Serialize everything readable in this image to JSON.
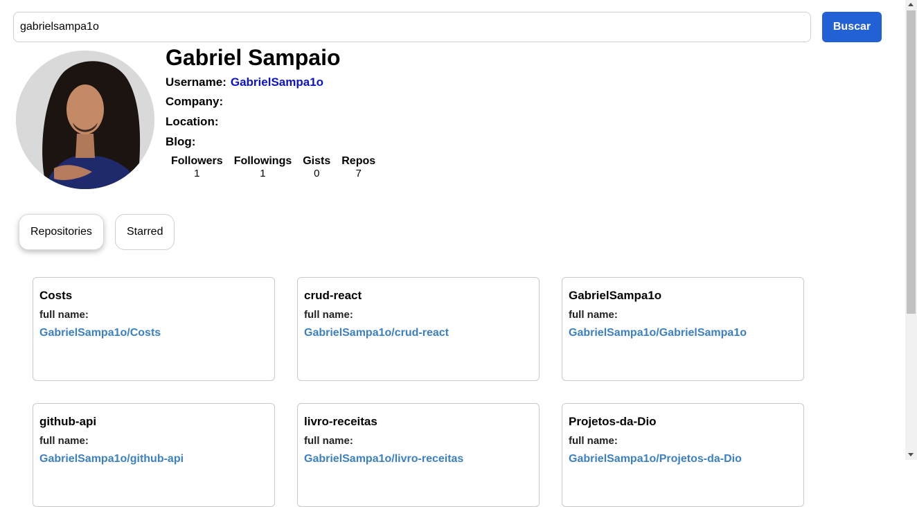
{
  "search": {
    "value": "gabrielsampa1o",
    "button_label": "Buscar"
  },
  "profile": {
    "name": "Gabriel Sampaio",
    "username_label": "Username:",
    "username": "GabrielSampa1o",
    "company_label": "Company:",
    "location_label": "Location:",
    "blog_label": "Blog:",
    "stats": [
      {
        "label": "Followers",
        "value": "1"
      },
      {
        "label": "Followings",
        "value": "1"
      },
      {
        "label": "Gists",
        "value": "0"
      },
      {
        "label": "Repos",
        "value": "7"
      }
    ]
  },
  "tabs": [
    {
      "label": "Repositories",
      "active": true
    },
    {
      "label": "Starred",
      "active": false
    }
  ],
  "repos": [
    {
      "name": "Costs",
      "full_name_label": "full name:",
      "full_name": "GabrielSampa1o/Costs"
    },
    {
      "name": "crud-react",
      "full_name_label": "full name:",
      "full_name": "GabrielSampa1o/crud-react"
    },
    {
      "name": "GabrielSampa1o",
      "full_name_label": "full name:",
      "full_name": "GabrielSampa1o/GabrielSampa1o"
    },
    {
      "name": "github-api",
      "full_name_label": "full name:",
      "full_name": "GabrielSampa1o/github-api"
    },
    {
      "name": "livro-receitas",
      "full_name_label": "full name:",
      "full_name": "GabrielSampa1o/livro-receitas"
    },
    {
      "name": "Projetos-da-Dio",
      "full_name_label": "full name:",
      "full_name": "GabrielSampa1o/Projetos-da-Dio"
    }
  ],
  "colors": {
    "accent": "#2260d6",
    "username_link": "#0b12c9",
    "repo_link": "#3b7fc4"
  }
}
